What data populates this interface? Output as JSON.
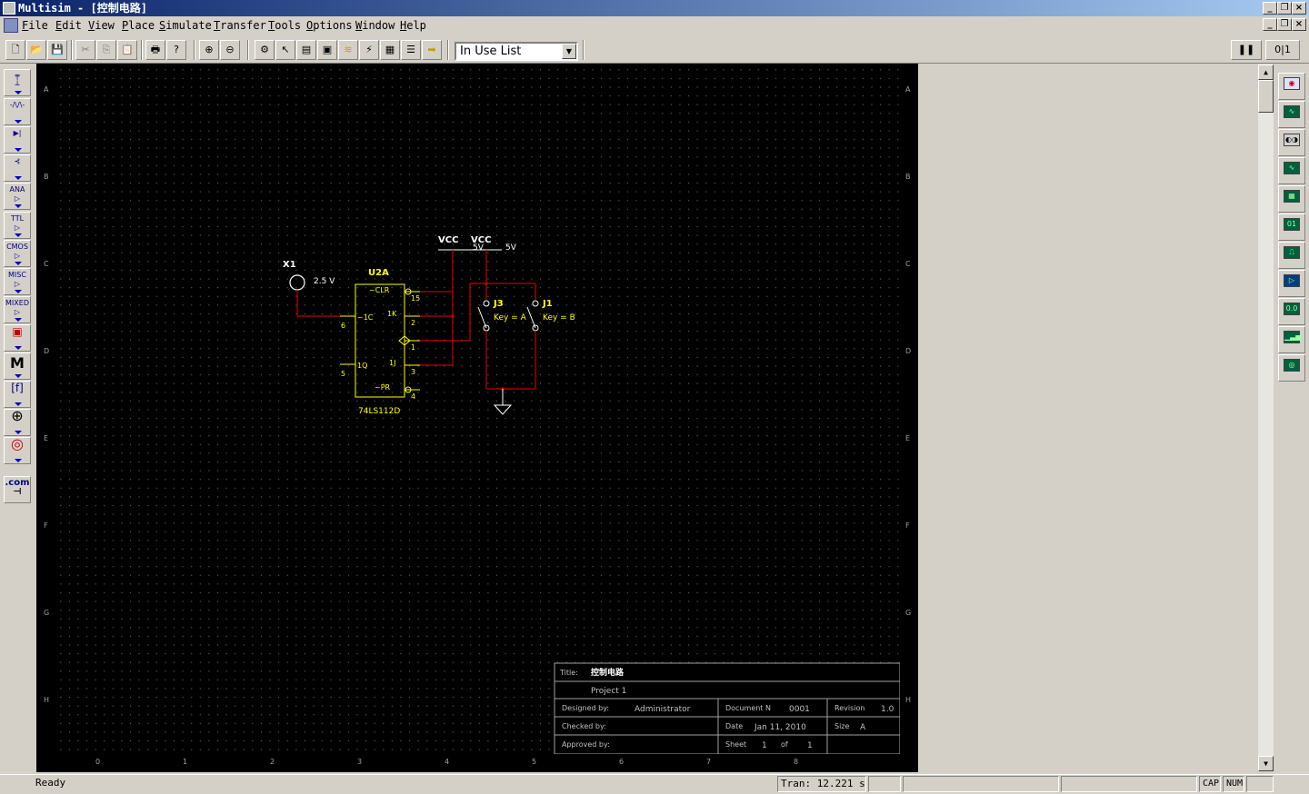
{
  "window": {
    "title": "Multisim - [控制电路]"
  },
  "menu": [
    "File",
    "Edit",
    "View",
    "Place",
    "Simulate",
    "Transfer",
    "Tools",
    "Options",
    "Window",
    "Help"
  ],
  "toolbar": {
    "in_use_list": "In Use List"
  },
  "left_toolbar": [
    "ANA",
    "TTL",
    "CMOS",
    "MISC",
    "MIXED",
    "M",
    ".com"
  ],
  "ruler": {
    "rows": [
      "A",
      "B",
      "C",
      "D",
      "E",
      "F",
      "G",
      "H"
    ],
    "cols": [
      "0",
      "1",
      "2",
      "3",
      "4",
      "5",
      "6",
      "7",
      "8"
    ]
  },
  "schematic": {
    "source_label": "X1",
    "source_value": "2.5 V",
    "ic_label": "U2A",
    "ic_part": "74LS112D",
    "ic_pins": {
      "clr": "~CLR",
      "k": "1K",
      "clk": "~1C",
      "j": "1J",
      "pre": "~PR",
      "q": "1Q",
      "p15": "15",
      "p2": "2",
      "p6": "6",
      "p1": "1",
      "p5": "5",
      "p3": "3",
      "p4": "4"
    },
    "vcc1": "VCC",
    "vcc1_value": "5V",
    "vcc2": "VCC",
    "vcc2_value": "5V",
    "switch1_label": "J3",
    "switch1_key": "Key = A",
    "switch2_label": "J1",
    "switch2_key": "Key = B"
  },
  "title_block": {
    "title_label": "Title:",
    "title_value": "控制电路",
    "project": "Project 1",
    "designed_by_label": "Designed by:",
    "designed_by": "Administrator",
    "document_label": "Document N",
    "document_value": "0001",
    "revision_label": "Revision",
    "revision_value": "1.0",
    "checked_by_label": "Checked by:",
    "date_label": "Date",
    "date_value": "Jan 11, 2010",
    "size_label": "Size",
    "size_value": "A",
    "approved_by_label": "Approved by:",
    "sheet_label": "Sheet",
    "sheet_value": "1",
    "of_label": "of",
    "of_value": "1"
  },
  "status": {
    "ready": "Ready",
    "tran": "Tran: 12.221 s",
    "cap": "CAP",
    "num": "NUM"
  },
  "colors": {
    "wire": "#c00000",
    "component": "#ffff00",
    "label": "#ffffff",
    "canvas": "#000000"
  }
}
